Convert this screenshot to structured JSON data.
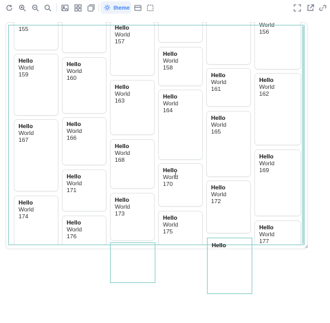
{
  "toolbar": {
    "left_icons": [
      {
        "name": "refresh-icon",
        "glyph": "refresh"
      },
      {
        "name": "zoom-in-icon",
        "glyph": "zoom-in"
      },
      {
        "name": "zoom-out-icon",
        "glyph": "zoom-out"
      },
      {
        "name": "zoom-reset-icon",
        "glyph": "search"
      },
      {
        "name": "image-icon",
        "glyph": "image"
      },
      {
        "name": "grid-icon",
        "glyph": "grid"
      },
      {
        "name": "layers-icon",
        "glyph": "layers"
      }
    ],
    "theme_label": "theme",
    "right_icons": [
      {
        "name": "panel-icon",
        "glyph": "panel"
      },
      {
        "name": "box-icon",
        "glyph": "box"
      },
      {
        "name": "fullscreen-icon",
        "glyph": "fullscreen"
      },
      {
        "name": "open-external-icon",
        "glyph": "external"
      },
      {
        "name": "link-icon",
        "glyph": "link"
      }
    ],
    "accent_color": "#3b82f6"
  },
  "cards": [
    {
      "title": "",
      "sub": "",
      "num": "155"
    },
    {
      "title": "",
      "sub": "",
      "num": ""
    },
    {
      "title": "Hello",
      "sub": "World",
      "num": "157"
    },
    {
      "title": "",
      "sub": "",
      "num": ""
    },
    {
      "title": "",
      "sub": "",
      "num": ""
    },
    {
      "title": "",
      "sub": "World",
      "num": "156"
    },
    {
      "title": "Hello",
      "sub": "World",
      "num": "159"
    },
    {
      "title": "Hello",
      "sub": "World",
      "num": "160"
    },
    {
      "title": "Hello",
      "sub": "World",
      "num": "158"
    },
    {
      "title": "Hello",
      "sub": "World",
      "num": "161"
    },
    {
      "title": "Hello",
      "sub": "World",
      "num": "162"
    },
    {
      "title": "Hello",
      "sub": "World",
      "num": "163"
    },
    {
      "title": "Hello",
      "sub": "World",
      "num": "164"
    },
    {
      "title": "Hello",
      "sub": "World",
      "num": "165"
    },
    {
      "title": "Hello",
      "sub": "World",
      "num": "167"
    },
    {
      "title": "Hello",
      "sub": "World",
      "num": "166"
    },
    {
      "title": "Hello",
      "sub": "World",
      "num": "168"
    },
    {
      "title": "Hello",
      "sub": "World",
      "num": "169"
    },
    {
      "title": "Hello",
      "sub": "World",
      "num": "170"
    },
    {
      "title": "Hello",
      "sub": "World",
      "num": "171"
    },
    {
      "title": "Hello",
      "sub": "World",
      "num": "172"
    },
    {
      "title": "Hello",
      "sub": "World",
      "num": "173"
    },
    {
      "title": "Hello",
      "sub": "World",
      "num": "174"
    },
    {
      "title": "Hello",
      "sub": "World",
      "num": "175"
    },
    {
      "title": "Hello",
      "sub": "World",
      "num": "176"
    },
    {
      "title": "Hello",
      "sub": "World",
      "num": "177"
    }
  ],
  "overflow_label": "Hello",
  "colors": {
    "selection": "#8ccfcb",
    "card_border": "#e3e5e8"
  }
}
